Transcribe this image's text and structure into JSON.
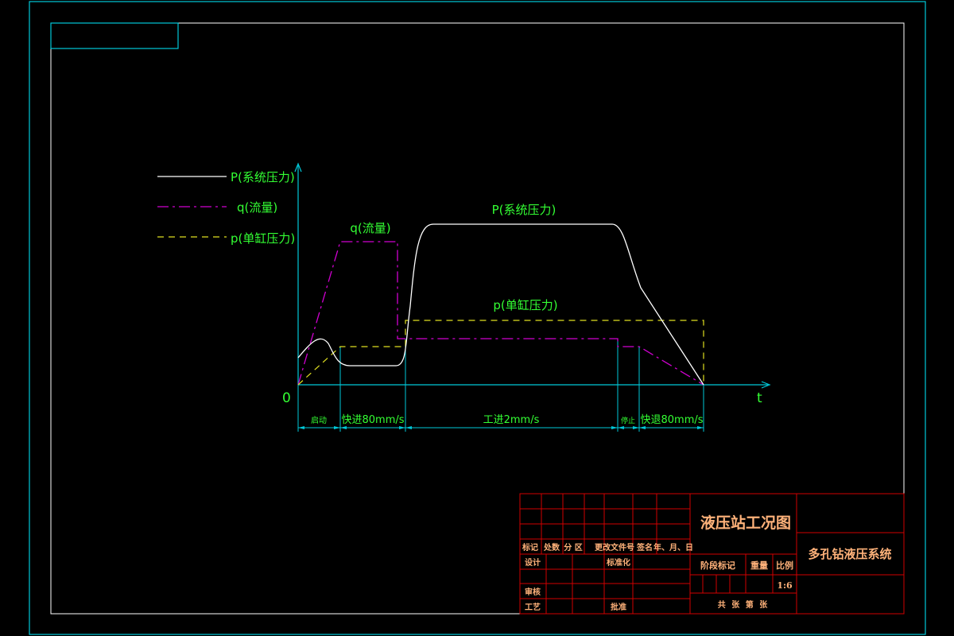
{
  "colors": {
    "frame": "#00c8d8",
    "axis": "#00c8d8",
    "system_pressure": "#ffffff",
    "flow": "#d000d0",
    "cylinder_pressure": "#e0e020",
    "text": "#33ff33",
    "title_block_lines": "#d00000",
    "title_block_text": "#ffb27a"
  },
  "legend": {
    "system_pressure": "P(系统压力)",
    "flow": "q(流量)",
    "cylinder_pressure": "p(单缸压力)"
  },
  "diagram": {
    "origin": "0",
    "x_axis": "t",
    "curve_labels": {
      "flow": "q(流量)",
      "system_pressure": "P(系统压力)",
      "cylinder_pressure": "p(单缸压力)"
    },
    "phases": [
      "启动",
      "快进80mm/s",
      "工进2mm/s",
      "停止",
      "快退80mm/s"
    ]
  },
  "title_block": {
    "drawing_title": "液压站工况图",
    "project_title": "多孔钻液压系统",
    "header_cells": [
      "标记",
      "处数",
      "分 区",
      "更改文件号",
      "签名",
      "年、月、日"
    ],
    "left_rows": [
      "设计",
      "审核",
      "工艺"
    ],
    "standardization": "标准化",
    "approval": "批准",
    "stage_mark": "阶段标记",
    "weight": "重量",
    "scale": "比例",
    "scale_value": "1:6",
    "sheet_info": "共 张 第 张"
  }
}
